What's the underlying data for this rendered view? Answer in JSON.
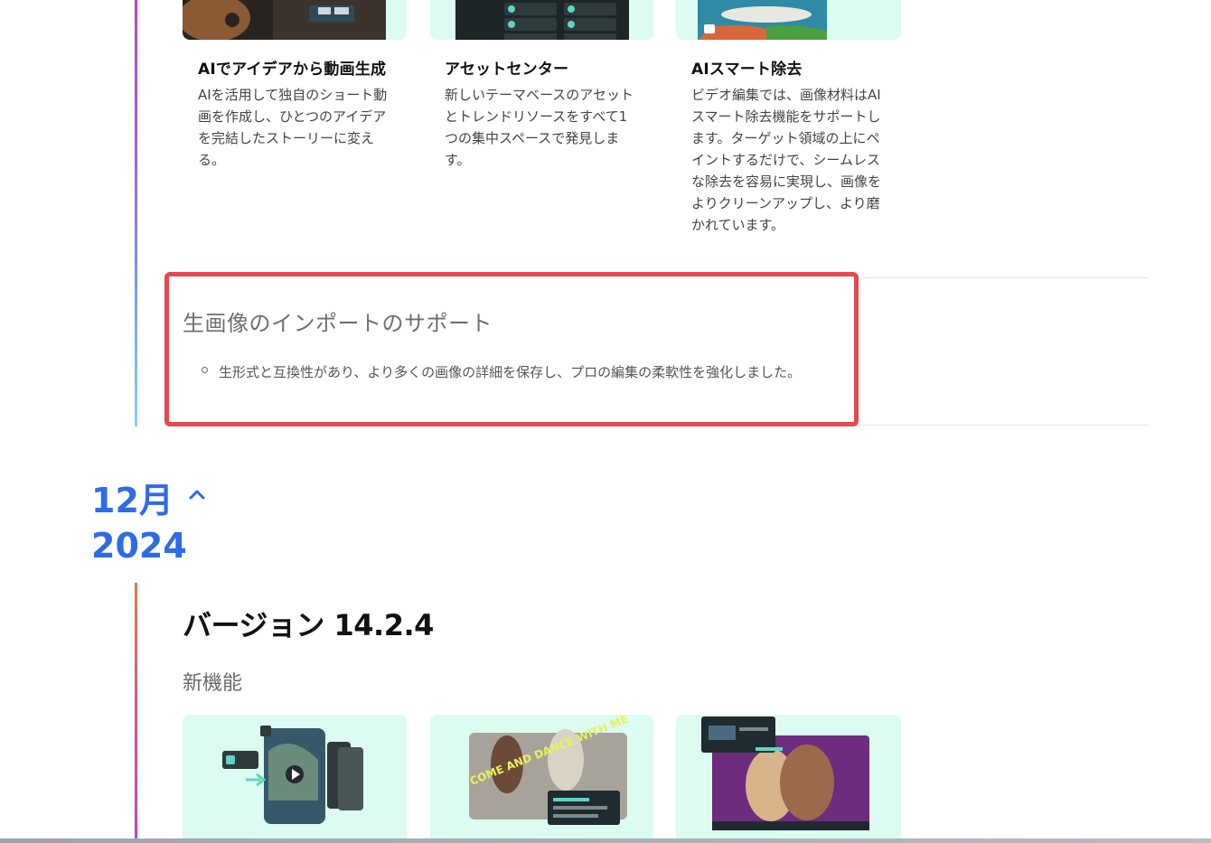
{
  "top_cards": [
    {
      "title": "AIでアイデアから動画生成",
      "description": "AIを活用して独自のショート動画を作成し、ひとつのアイデアを完結したストーリーに変える。"
    },
    {
      "title": "アセットセンター",
      "description": "新しいテーマベースのアセットとトレンドリソースをすべて1つの集中スペースで発見します。"
    },
    {
      "title": "AIスマート除去",
      "description": "ビデオ編集では、画像材料はAIスマート除去機能をサポートします。ターゲット領域の上にペイントするだけで、シームレスな除去を容易に実現し、画像をよりクリーンアップし、より磨かれています。"
    }
  ],
  "support_section": {
    "title": "生画像のインポートのサポート",
    "bullet": "生形式と互換性があり、より多くの画像の詳細を保存し、プロの編集の柔軟性を強化しました。"
  },
  "month_heading": {
    "month": "12月",
    "year": "2024",
    "toggle_icon": "chevron-up-icon"
  },
  "release": {
    "version": "バージョン 14.2.4",
    "section_label": "新機能",
    "thumb_texts": {
      "dance_caption": "COME AND DANCE WITH ME"
    }
  },
  "colors": {
    "accent_blue": "#2f6be5",
    "highlight_red": "#e5484f",
    "card_bg": "#dcfbf1"
  }
}
